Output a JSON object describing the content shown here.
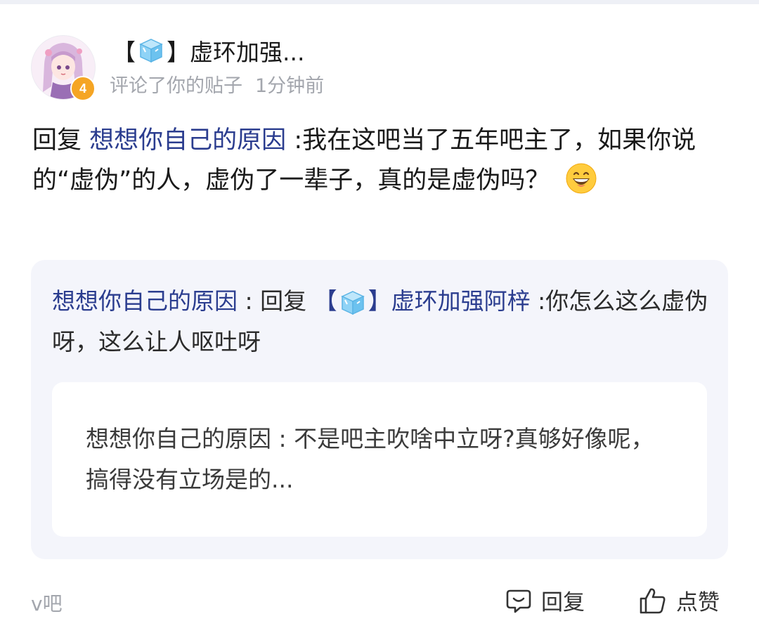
{
  "header": {
    "username_prefix": "【",
    "username_suffix": "】虚环加强...",
    "action_text": "评论了你的贴子",
    "time": "1分钟前",
    "level": "4",
    "icon_names": {
      "avatar": "anime-avatar-image",
      "badge": "level-badge",
      "username_icon": "ice-cube-icon"
    }
  },
  "reply": {
    "prefix": "回复",
    "mention": "想想你自己的原因",
    "text": ":我在这吧当了五年吧主了，如果你说的“虚伪”的人，虚伪了一辈子，真的是虚伪吗？",
    "emoji": "grinning-face-emoji"
  },
  "quote": {
    "author": "想想你自己的原因",
    "separator": " : 回复 ",
    "mention_prefix": "【",
    "mention_suffix": "】虚环加强阿梓",
    "text": " :你怎么这么虚伪呀，这么让人呕吐呀",
    "nested": {
      "author": "想想你自己的原因",
      "text": " : 不是吧主吹啥中立呀?真够好像呢，搞得没有立场是的..."
    }
  },
  "footer": {
    "forum": "v吧",
    "reply_label": "回复",
    "like_label": "点赞",
    "reply_icon": "comment-bubble-icon",
    "like_icon": "thumbs-up-icon"
  },
  "colors": {
    "link": "#2b3d8f",
    "muted": "#a3a6ad",
    "card_bg": "#f4f5fb",
    "badge": "#f5a524"
  }
}
